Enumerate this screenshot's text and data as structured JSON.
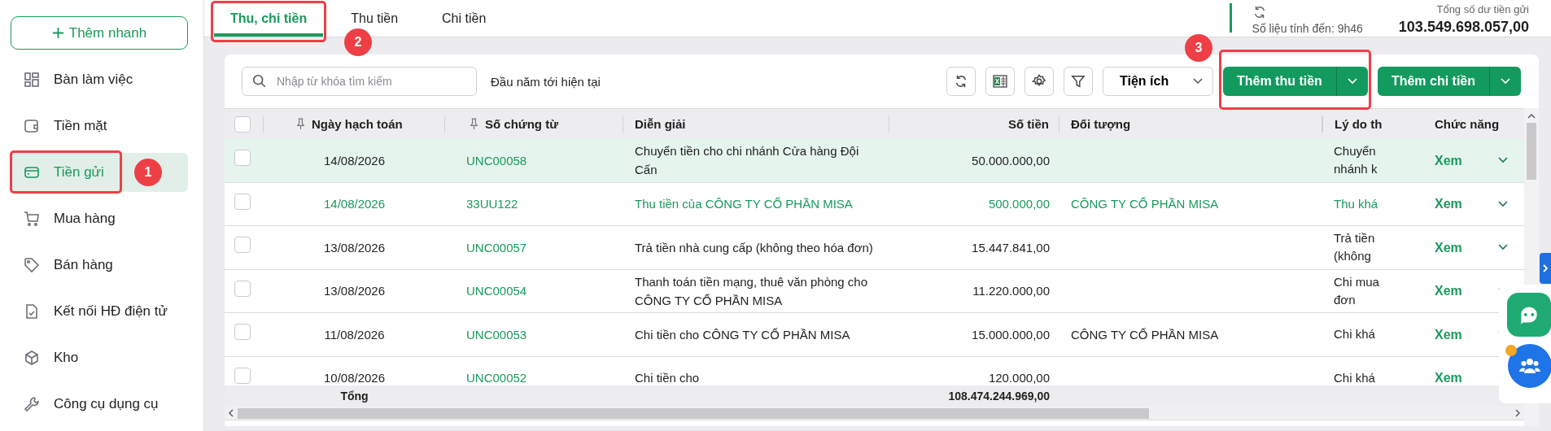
{
  "sidebar": {
    "quick_add": "Thêm nhanh",
    "items": [
      {
        "label": "Bàn làm việc",
        "selected": false
      },
      {
        "label": "Tiền mặt",
        "selected": false
      },
      {
        "label": "Tiền gửi",
        "selected": true,
        "callout": "1"
      },
      {
        "label": "Mua hàng",
        "selected": false
      },
      {
        "label": "Bán hàng",
        "selected": false
      },
      {
        "label": "Kết nối HĐ điện tử",
        "selected": false
      },
      {
        "label": "Kho",
        "selected": false
      },
      {
        "label": "Công cụ dụng cụ",
        "selected": false
      }
    ]
  },
  "tabs": [
    {
      "label": "Thu, chi tiền",
      "selected": true,
      "callout": "2"
    },
    {
      "label": "Thu tiền",
      "selected": false
    },
    {
      "label": "Chi tiền",
      "selected": false
    }
  ],
  "header_info": {
    "sync_time": "Số liệu tính đến: 9h46",
    "balance_label": "Tổng số dư tiền gửi",
    "balance": "103.549.698.057,00"
  },
  "toolbar": {
    "search_placeholder": "Nhập từ khóa tìm kiếm",
    "period": "Đầu năm tới hiện tại",
    "utility_menu": "Tiện ích",
    "buttons": [
      {
        "label": "Thêm thu tiền",
        "callout": "3"
      },
      {
        "label": "Thêm chi tiền"
      }
    ]
  },
  "table": {
    "select_all_checked": false,
    "columns": [
      {
        "label": "Ngày hạch toán",
        "pinned": true
      },
      {
        "label": "Số chứng từ",
        "pinned": true
      },
      {
        "label": "Diễn giải",
        "pinned": false
      },
      {
        "label": "Số tiền",
        "pinned": false
      },
      {
        "label": "Đối tượng",
        "pinned": false
      },
      {
        "label": "Lý do th",
        "pinned": false
      },
      {
        "label": "Chức năng",
        "pinned": false
      }
    ],
    "rows": [
      {
        "selected": true,
        "checked": false,
        "kind": "payment",
        "date": "14/08/2026",
        "doc_no": "UNC00058",
        "description": "Chuyển tiền cho chi nhánh Cửa hàng Đội Cấn",
        "amount": "50.000.000,00",
        "reason": [
          "Chuyển",
          "nhánh k"
        ],
        "action": "Xem"
      },
      {
        "selected": false,
        "checked": false,
        "kind": "receipt",
        "date": "14/08/2026",
        "doc_no": "33UU122",
        "description": "Thu tiền của CÔNG TY CỔ PHẦN MISA",
        "amount": "500.000,00",
        "counterparty": "CÔNG TY CỔ PHẦN MISA",
        "reason": [
          "Thu khá"
        ],
        "action": "Xem"
      },
      {
        "selected": false,
        "checked": false,
        "kind": "payment",
        "date": "13/08/2026",
        "doc_no": "UNC00057",
        "description": "Trả tiền nhà cung cấp (không theo hóa đơn)",
        "amount": "15.447.841,00",
        "reason": [
          "Trả tiền",
          "(không"
        ],
        "action": "Xem"
      },
      {
        "selected": false,
        "checked": false,
        "kind": "payment",
        "date": "13/08/2026",
        "doc_no": "UNC00054",
        "description": "Thanh toán tiền mạng, thuê văn phòng cho CÔNG TY CỔ PHẦN MISA",
        "amount": "11.220.000,00",
        "reason": [
          "Chi mua",
          "đơn"
        ],
        "action": "Xem"
      },
      {
        "selected": false,
        "checked": false,
        "kind": "payment",
        "date": "11/08/2026",
        "doc_no": "UNC00053",
        "description": "Chi tiền cho CÔNG TY CỔ PHẦN MISA",
        "amount": "15.000.000,00",
        "counterparty": "CÔNG TY CỔ PHẦN MISA",
        "reason": [
          "Chi khá"
        ],
        "action": "Xem"
      },
      {
        "selected": false,
        "checked": false,
        "kind": "payment",
        "date": "10/08/2026",
        "doc_no": "UNC00052",
        "description": "Chi tiền cho",
        "amount": "120.000,00",
        "reason": [
          "Chi khá"
        ],
        "action": "Xem"
      }
    ],
    "total_label": "Tổng",
    "total_amount": "108.474.244.969,00"
  }
}
